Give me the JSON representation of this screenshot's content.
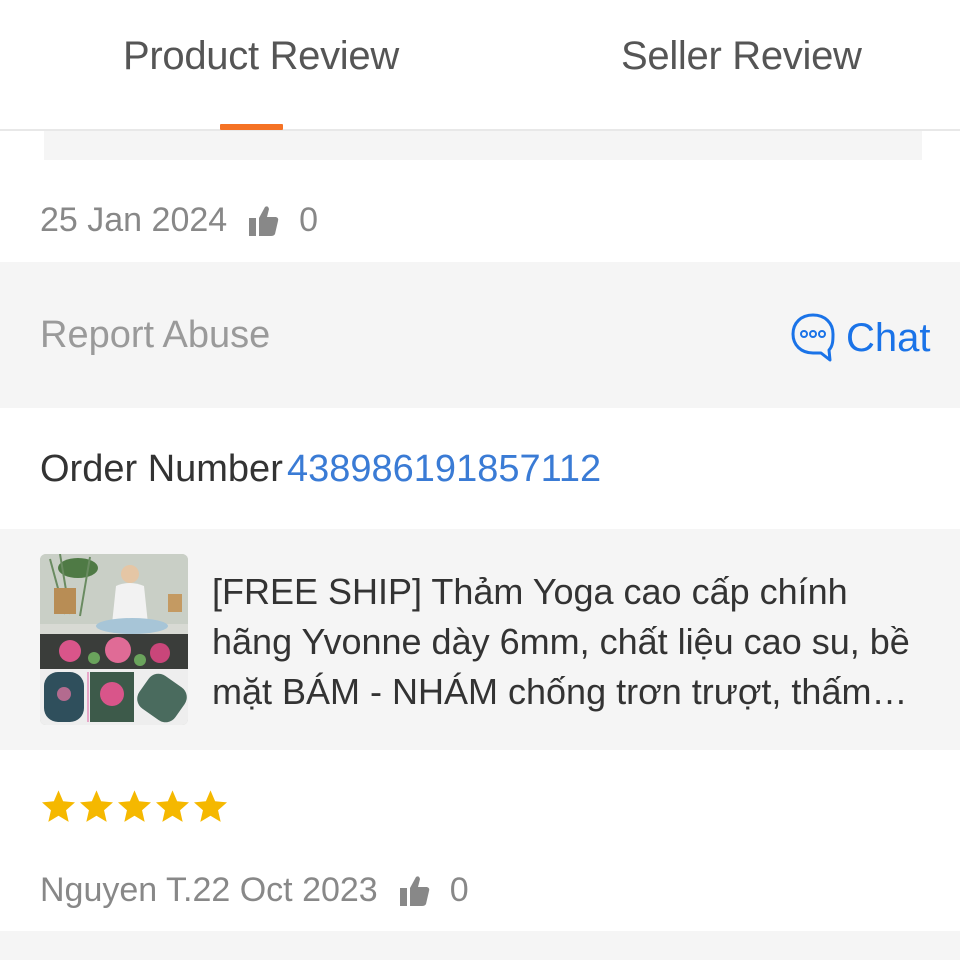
{
  "tabs": {
    "product_review": "Product Review",
    "seller_review": "Seller Review",
    "active": "product_review",
    "accent_color": "#f57224"
  },
  "review_1": {
    "date": "25 Jan 2024",
    "likes": "0"
  },
  "actions": {
    "report_abuse": "Report Abuse",
    "chat": "Chat",
    "chat_color": "#1a73e8"
  },
  "order": {
    "label": "Order Number",
    "number": "438986191857112"
  },
  "product": {
    "title": "[FREE SHIP] Thảm Yoga cao cấp chính hãng Yvonne dày 6mm, chất liệu cao su, bề mặt BÁM - NHÁM chống trơn trượt, thấm mồ hôi",
    "image_icon": "yoga-mat-product-photo"
  },
  "review_2": {
    "rating": 5,
    "rating_max": 5,
    "author_date": "Nguyen T.22 Oct 2023",
    "likes": "0",
    "star_color": "#f5b800"
  }
}
